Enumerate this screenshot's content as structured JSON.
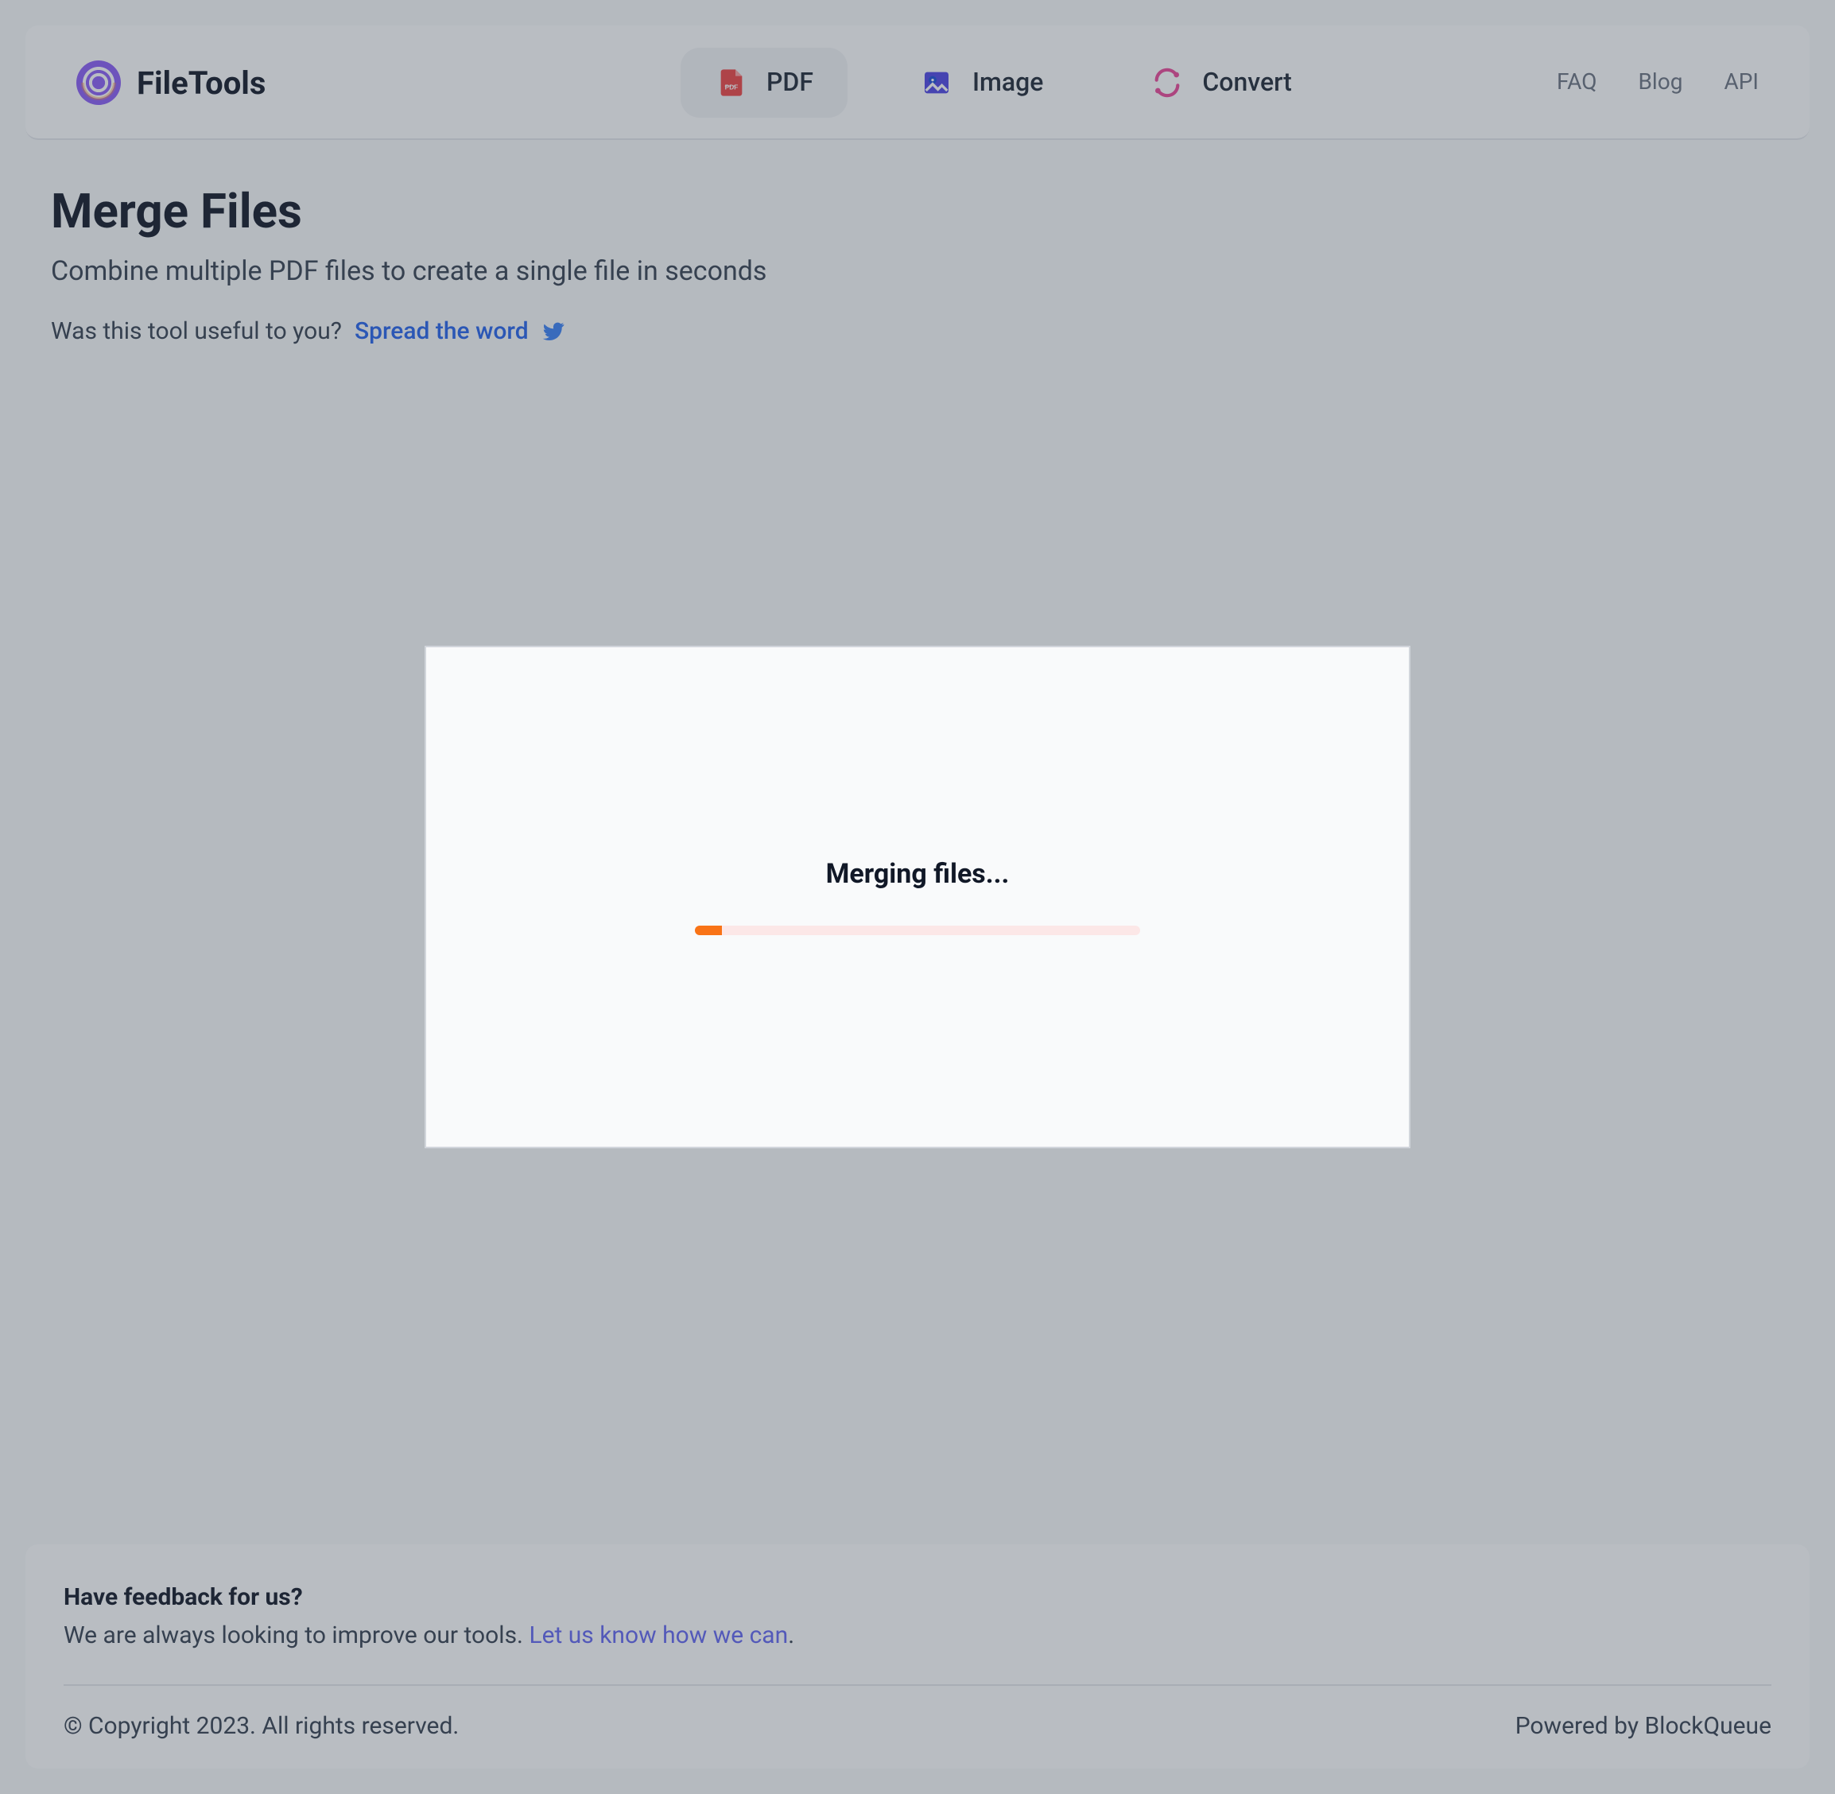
{
  "brand": {
    "name": "FileTools"
  },
  "nav": {
    "items": [
      {
        "label": "PDF"
      },
      {
        "label": "Image"
      },
      {
        "label": "Convert"
      }
    ],
    "right": [
      {
        "label": "FAQ"
      },
      {
        "label": "Blog"
      },
      {
        "label": "API"
      }
    ]
  },
  "page": {
    "title": "Merge Files",
    "subtitle": "Combine multiple PDF files to create a single file in seconds",
    "share_prompt": "Was this tool useful to you?",
    "share_link": "Spread the word"
  },
  "modal": {
    "title": "Merging files...",
    "progress_percent": 6
  },
  "footer": {
    "feedback_title": "Have feedback for us?",
    "feedback_text": "We are always looking to improve our tools. ",
    "feedback_link": "Let us know how we can",
    "feedback_suffix": ".",
    "copyright": "© Copyright 2023. All rights reserved.",
    "powered": "Powered by BlockQueue"
  },
  "colors": {
    "accent_orange": "#f97316",
    "link_blue": "#2563eb",
    "link_indigo": "#6366f1"
  }
}
